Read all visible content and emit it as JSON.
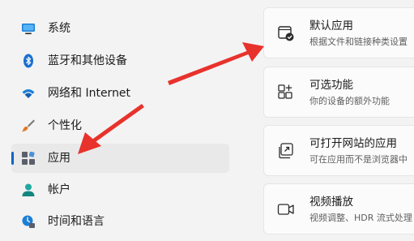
{
  "sidebar": {
    "items": [
      {
        "label": "系统",
        "icon": "system-monitor-icon",
        "selected": false
      },
      {
        "label": "蓝牙和其他设备",
        "icon": "bluetooth-icon",
        "selected": false
      },
      {
        "label": "网络和 Internet",
        "icon": "wifi-icon",
        "selected": false
      },
      {
        "label": "个性化",
        "icon": "paintbrush-icon",
        "selected": false
      },
      {
        "label": "应用",
        "icon": "apps-icon",
        "selected": true
      },
      {
        "label": "帐户",
        "icon": "account-icon",
        "selected": false
      },
      {
        "label": "时间和语言",
        "icon": "time-language-icon",
        "selected": false
      }
    ]
  },
  "main": {
    "cards": [
      {
        "title": "默认应用",
        "description": "根据文件和链接种类设置",
        "icon": "default-apps-icon"
      },
      {
        "title": "可选功能",
        "description": "你的设备的额外功能",
        "icon": "optional-features-icon"
      },
      {
        "title": "可打开网站的应用",
        "description": "可在应用而不是浏览器中",
        "icon": "apps-for-websites-icon"
      },
      {
        "title": "视频播放",
        "description": "视频调整、HDR 流式处理",
        "icon": "video-playback-icon"
      }
    ]
  },
  "colors": {
    "accent": "#0067c0",
    "annotation_arrow": "#e8322c",
    "selected_background": "#e9e9e9",
    "card_background": "#fbfbfb"
  }
}
